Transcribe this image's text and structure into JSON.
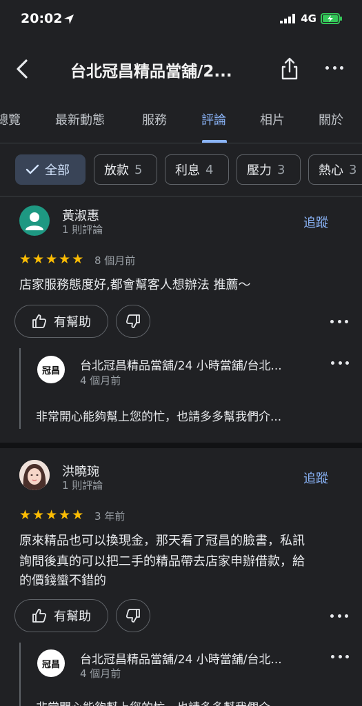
{
  "status": {
    "time": "20:02",
    "network": "4G"
  },
  "header": {
    "title": "台北冠昌精品當舖/2..."
  },
  "tabs": [
    {
      "label": "總覽"
    },
    {
      "label": "最新動態"
    },
    {
      "label": "服務"
    },
    {
      "label": "評論"
    },
    {
      "label": "相片"
    },
    {
      "label": "關於"
    }
  ],
  "chips": [
    {
      "label": "全部",
      "count": ""
    },
    {
      "label": "放款",
      "count": "5"
    },
    {
      "label": "利息",
      "count": "4"
    },
    {
      "label": "壓力",
      "count": "3"
    },
    {
      "label": "熱心",
      "count": "3"
    }
  ],
  "reviews": [
    {
      "name": "黃淑惠",
      "sub": "1 則評論",
      "follow": "追蹤",
      "stars": 5,
      "date": "8 個月前",
      "text": "店家服務態度好,都會幫客人想辦法 推薦～",
      "helpful": "有幫助",
      "reply": {
        "owner": "台北冠昌精品當舖/24 小時當舖/台北...",
        "date": "4 個月前",
        "text": "非常開心能夠幫上您的忙，也請多多幫我們介..."
      }
    },
    {
      "name": "洪曉琬",
      "sub": "1 則評論",
      "follow": "追蹤",
      "stars": 5,
      "date": "3 年前",
      "text_lines": [
        "原來精品也可以換現金，那天看了冠昌的臉書，私訊",
        "詢問後真的可以把二手的精品帶去店家申辦借款，給",
        "的價錢蠻不錯的"
      ],
      "helpful": "有幫助",
      "reply": {
        "owner": "台北冠昌精品當舖/24 小時當舖/台北...",
        "date": "4 個月前",
        "text": "非常開心能夠幫上您的忙，也請多多幫我們介..."
      }
    }
  ],
  "icons": {
    "star": "★",
    "owner_logo_text": "冠昌"
  },
  "colors": {
    "accent": "#8ab4f8",
    "star": "#fbbc04",
    "bg": "#202124"
  }
}
